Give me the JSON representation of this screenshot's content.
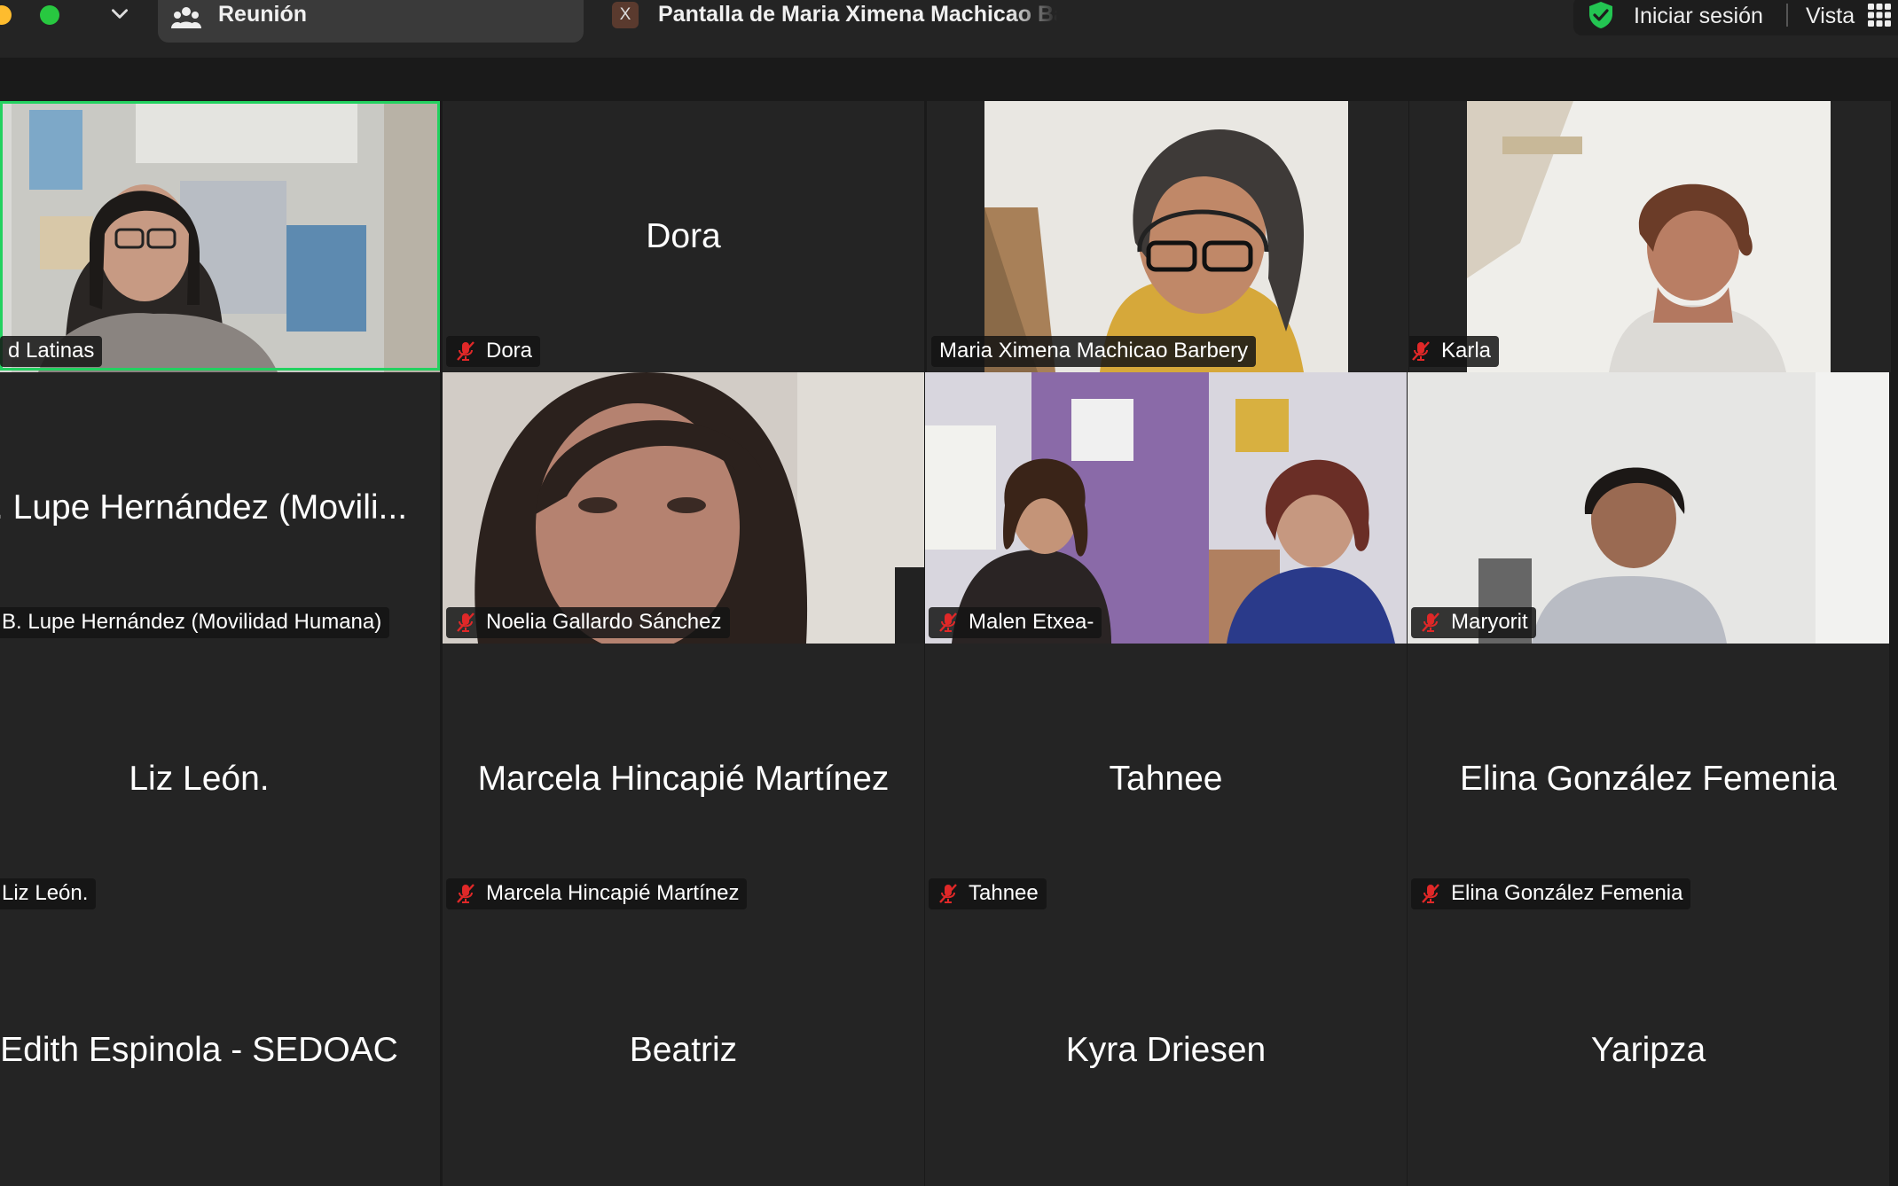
{
  "titlebar": {
    "meeting_tab_label": "Reunión",
    "share_tab_close": "X",
    "share_tab_label": "Pantalla de Maria Ximena Machicao Barbery",
    "signin_label": "Iniciar sesión",
    "view_label": "Vista"
  },
  "participants": [
    {
      "name": "d Latinas",
      "video": true,
      "muted": false,
      "active_speaker": true
    },
    {
      "name": "Dora",
      "video": false,
      "muted": true,
      "center_name": "Dora"
    },
    {
      "name": "Maria Ximena Machicao Barbery",
      "video": true,
      "muted": false
    },
    {
      "name": "Karla",
      "video": true,
      "muted": true
    },
    {
      "name": "B. Lupe Hernández (Movilidad Humana)",
      "video": false,
      "muted": false,
      "center_name": ". Lupe Hernández (Movili..."
    },
    {
      "name": "Noelia Gallardo Sánchez",
      "video": true,
      "muted": true
    },
    {
      "name": "Malen Etxea-",
      "video": true,
      "muted": true
    },
    {
      "name": "Maryorit",
      "video": true,
      "muted": true
    },
    {
      "name": "Liz León.",
      "video": false,
      "muted": false,
      "center_name": "Liz León."
    },
    {
      "name": "Marcela Hincapié Martínez",
      "video": false,
      "muted": true,
      "center_name": "Marcela Hincapié Martínez"
    },
    {
      "name": "Tahnee",
      "video": false,
      "muted": true,
      "center_name": "Tahnee"
    },
    {
      "name": "Elina González Femenia",
      "video": false,
      "muted": true,
      "center_name": "Elina González Femenia"
    },
    {
      "name": "Edith Espinola - SEDOAC",
      "video": false,
      "center_name": "Edith Espinola - SEDOAC"
    },
    {
      "name": "Beatriz",
      "video": false,
      "center_name": "Beatriz"
    },
    {
      "name": "Kyra Driesen",
      "video": false,
      "center_name": "Kyra Driesen"
    },
    {
      "name": "Yaripza",
      "video": false,
      "center_name": "Yaripza"
    }
  ],
  "colors": {
    "active_speaker_border": "#23d160",
    "muted_icon": "#e02828",
    "background": "#1a1a1a"
  }
}
